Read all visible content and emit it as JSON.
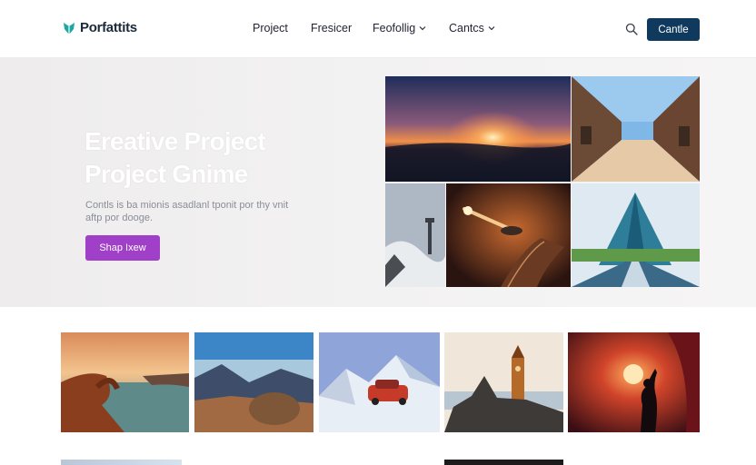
{
  "header": {
    "logo_text": "Porfattits",
    "nav": [
      {
        "label": "Project",
        "has_dropdown": false
      },
      {
        "label": "Fresicer",
        "has_dropdown": false
      },
      {
        "label": "Feofollig",
        "has_dropdown": true
      },
      {
        "label": "Cantcs",
        "has_dropdown": true
      }
    ],
    "search_icon": "search-icon",
    "cta_label": "Cantle"
  },
  "hero": {
    "title_line1": "Ereative Project",
    "title_line2": "Project Gnime",
    "description": "Contls is ba mionis asadlanl tponit por thy vnit aftp por dooge.",
    "button_label": "Shap Ixew"
  },
  "colors": {
    "primary_navy": "#0f3a5e",
    "accent_purple": "#a03fc8",
    "logo_teal": "#1aa8a0"
  }
}
